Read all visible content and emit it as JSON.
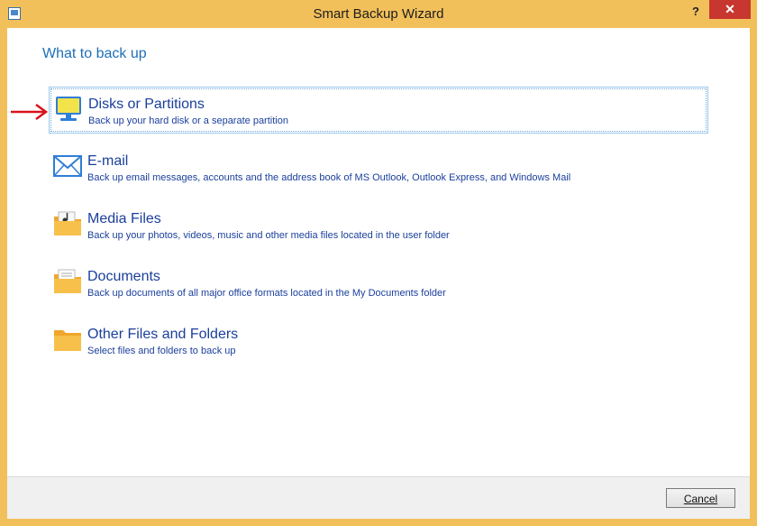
{
  "window": {
    "title": "Smart Backup Wizard",
    "help": "?",
    "close": "✕"
  },
  "heading": "What to back up",
  "options": [
    {
      "title": "Disks or Partitions",
      "desc": "Back up your hard disk or a separate partition",
      "icon": "monitor-icon",
      "selected": true
    },
    {
      "title": "E-mail",
      "desc": "Back up email messages, accounts and the address book of MS Outlook, Outlook Express, and Windows Mail",
      "icon": "envelope-icon",
      "selected": false
    },
    {
      "title": "Media Files",
      "desc": "Back up your photos, videos, music and other media files located in the user folder",
      "icon": "media-folder-icon",
      "selected": false
    },
    {
      "title": "Documents",
      "desc": "Back up documents of all major office formats located in the My Documents folder",
      "icon": "documents-folder-icon",
      "selected": false
    },
    {
      "title": "Other Files and Folders",
      "desc": "Select files and folders to back up",
      "icon": "folder-icon",
      "selected": false
    }
  ],
  "buttons": {
    "cancel": "Cancel"
  },
  "colors": {
    "titlebar": "#f2c05b",
    "link_text": "#1a3f9c",
    "heading": "#1e6fb8",
    "close": "#c7372f",
    "arrow": "#d9121a"
  }
}
